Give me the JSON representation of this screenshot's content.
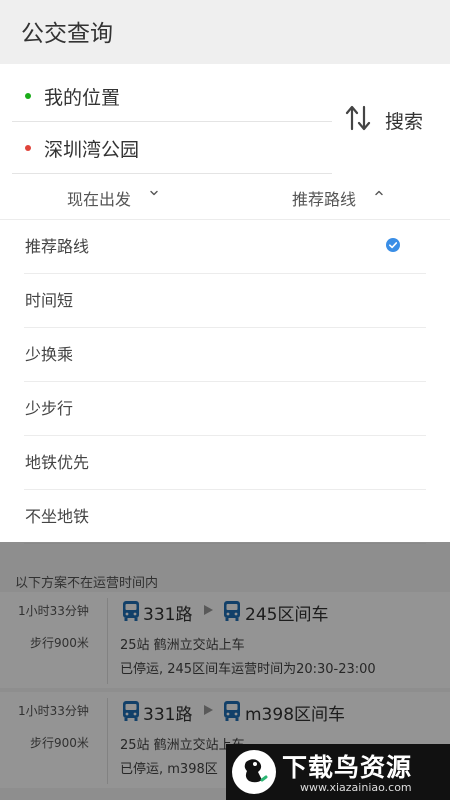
{
  "header": {
    "title": "公交查询"
  },
  "route": {
    "origin": "我的位置",
    "destination": "深圳湾公园",
    "origin_dot_color": "#1aad19",
    "destination_dot_color": "#e0433a",
    "search_label": "搜索",
    "swap_icon": "swap-vertical-icon"
  },
  "filters": {
    "time": "现在出发",
    "sort": "推荐路线",
    "time_chevron": "chevron-down-icon",
    "sort_chevron": "chevron-up-icon"
  },
  "dropdown": {
    "selected_index": 0,
    "check_color": "#3a8ee6",
    "options": [
      {
        "label": "推荐路线"
      },
      {
        "label": "时间短"
      },
      {
        "label": "少换乘"
      },
      {
        "label": "少步行"
      },
      {
        "label": "地铁优先"
      },
      {
        "label": "不坐地铁"
      }
    ]
  },
  "results": {
    "section_label": "以下方案不在运营时间内",
    "bus_icon_color": "#1f6fb5",
    "plans": [
      {
        "duration": "1小时33分钟",
        "walk": "步行900米",
        "line1": "331路",
        "line2": "245区间车",
        "stops": "25站  鹤洲立交站上车",
        "status": "已停运, 245区间车运营时间为20:30-23:00"
      },
      {
        "duration": "1小时33分钟",
        "walk": "步行900米",
        "line1": "331路",
        "line2": "m398区间车",
        "stops": "25站  鹤洲立交站上车",
        "status": "已停运, m398区"
      }
    ]
  },
  "watermark": {
    "title": "下载鸟资源",
    "url": "www.xiazainiao.com"
  }
}
